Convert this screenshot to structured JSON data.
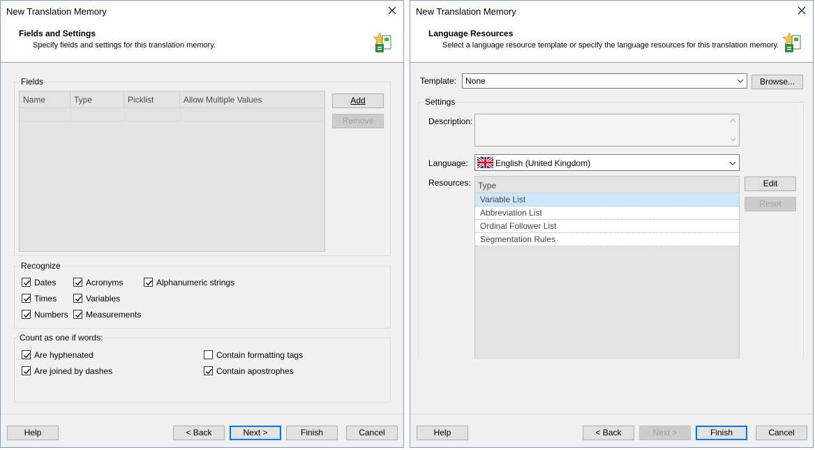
{
  "left": {
    "title": "New Translation Memory",
    "header_title": "Fields and Settings",
    "header_subtitle": "Specify fields and settings for this translation memory.",
    "fields_group": "Fields",
    "columns": [
      "Name",
      "Type",
      "Picklist",
      "Allow Multiple Values"
    ],
    "add_label": "Add",
    "remove_label": "Remove",
    "recognize_group": "Recognize",
    "recognize": [
      {
        "label": "Dates",
        "checked": true
      },
      {
        "label": "Times",
        "checked": true
      },
      {
        "label": "Numbers",
        "checked": true
      },
      {
        "label": "Acronyms",
        "checked": true
      },
      {
        "label": "Variables",
        "checked": true
      },
      {
        "label": "Measurements",
        "checked": true
      },
      {
        "label": "Alphanumeric strings",
        "checked": true
      }
    ],
    "count_group": "Count as one if words:",
    "count": [
      {
        "label": "Are hyphenated",
        "checked": true
      },
      {
        "label": "Are joined by dashes",
        "checked": true
      },
      {
        "label": "Contain formatting tags",
        "checked": false
      },
      {
        "label": "Contain apostrophes",
        "checked": true
      }
    ],
    "buttons": {
      "help": "Help",
      "back": "< Back",
      "next": "Next >",
      "finish": "Finish",
      "cancel": "Cancel"
    }
  },
  "right": {
    "title": "New Translation Memory",
    "header_title": "Language Resources",
    "header_subtitle": "Select a language resource template or specify the language resources for this translation memory.",
    "template_label": "Template:",
    "template_value": "None",
    "browse_label": "Browse...",
    "settings_group": "Settings",
    "description_label": "Description:",
    "description_value": "",
    "language_label": "Language:",
    "language_value": "English (United Kingdom)",
    "resources_label": "Resources:",
    "resources_column": "Type",
    "resources": [
      "Variable List",
      "Abbreviation List",
      "Ordinal Follower List",
      "Segmentation Rules"
    ],
    "edit_label": "Edit",
    "reset_label": "Reset",
    "buttons": {
      "help": "Help",
      "back": "< Back",
      "next": "Next >",
      "finish": "Finish",
      "cancel": "Cancel"
    }
  },
  "colors": {
    "accent": "#0078d7",
    "selection": "#cce8ff",
    "window_bg": "#f0f0f0"
  }
}
